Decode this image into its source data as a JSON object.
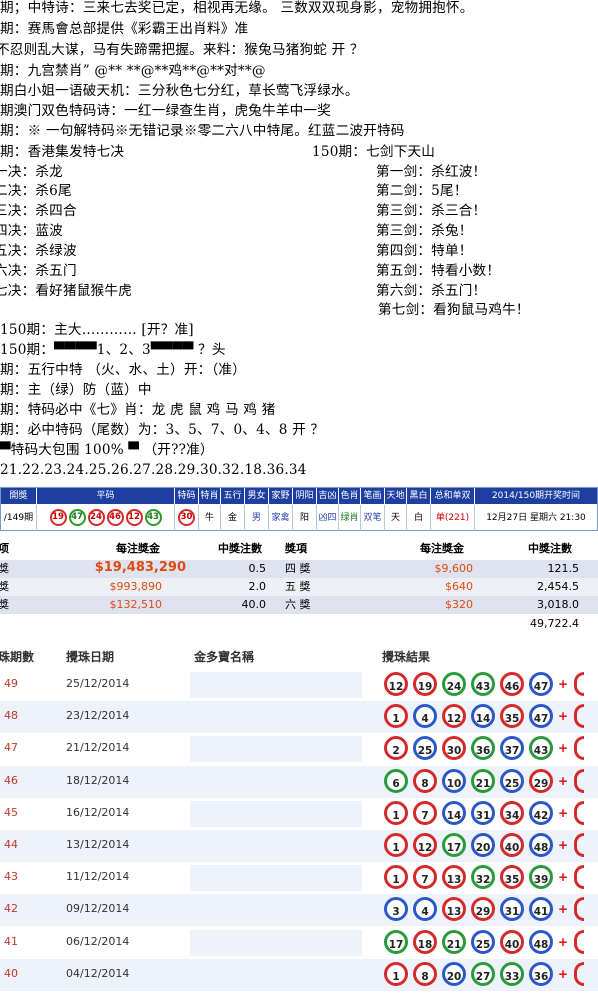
{
  "text_lines": [
    "期；中特诗：三来七去奖已定，相视再无缘。 三数双双现身影，宠物拥抱怀。",
    "期：赛馬會总部提供《彩霸王出肖料》准",
    "不忍则乱大谋，马有失蹄需把握。来料：猴兔马猪狗蛇   开  ？",
    "期：九宫禁肖” @** **@**鸡**@**对**@",
    "期白小姐一语破天机：三分秋色七分红，草长莺飞浮绿水。",
    "期澳门双色特码诗：一红一绿查生肖，虎兔牛羊中一奖",
    "期：※ 一句解特码※无错记录※零二六八中特尾。红蓝二波开特码",
    "期：香港集发特七决"
  ],
  "jue_header": "150期：七剑下天山",
  "jue_left": [
    "一决：杀龙",
    "二决：杀6尾",
    "三决：杀四合",
    "四决：蓝波",
    "五决：杀绿波",
    "六决：杀五门",
    "七决：看好猪鼠猴牛虎"
  ],
  "jian_right": [
    "第一剑：杀红波！",
    "第二剑：5尾！",
    "第三剑：杀三合！",
    "第三剑：杀兔！",
    "第四剑：特单！",
    "第五剑：特看小数！",
    "第六剑：杀五门！",
    "第七剑：看狗鼠马鸡牛！"
  ],
  "lines2": [
    "150期：主大………… [开？准]",
    "150期：▀▀▀▀1、2、3▀▀▀▀ ？头",
    "期：五行中特  （火、水、土）开：（准）",
    "期：主（绿）防（蓝）中",
    "期：特码必中《七》肖：龙 虎 鼠 鸡 马 鸡 猪",
    "期：必中特码（尾数）为：3、5、7、0、4、8  开 ？",
    "▀特码大包围 100%  ▀  （开??准）",
    "21.22.23.24.25.26.27.28.29.30.32.18.36.34"
  ],
  "strip": {
    "headers": [
      "開獎",
      "平码",
      "特码",
      "特肖",
      "五行",
      "男女",
      "家野",
      "阴阳",
      "吉凶",
      "色肖",
      "笔画",
      "天地",
      "黑白",
      "总和单双",
      "2014/150期开奖时间"
    ],
    "period": "/149期",
    "numbers": [
      "19",
      "47",
      "24",
      "46",
      "12",
      "43"
    ],
    "special": "30",
    "values": [
      "牛",
      "金",
      "男",
      "家禽",
      "阳",
      "凶四",
      "绿肖",
      "双笔",
      "天",
      "白",
      "单(221)",
      "12月27日 星期六 21:30"
    ]
  },
  "prize": {
    "headers": [
      "项",
      "每注獎金",
      "中獎注數",
      "獎項",
      "每注獎金",
      "中獎注數"
    ],
    "rows": [
      [
        "獎",
        "$19,483,290",
        "0.5",
        "四 獎",
        "$9,600",
        "121.5"
      ],
      [
        "獎",
        "$993,890",
        "2.0",
        "五 獎",
        "$640",
        "2,454.5"
      ],
      [
        "獎",
        "$132,510",
        "40.0",
        "六 獎",
        "$320",
        "3,018.0"
      ]
    ],
    "total": "49,722.4"
  },
  "history": {
    "headers": [
      "攪珠期數",
      "攪珠日期",
      "金多寶名稱",
      "攪珠結果"
    ],
    "rows": [
      {
        "no": "49",
        "date": "25/12/2014",
        "balls": [
          "12",
          "19",
          "24",
          "43",
          "46",
          "47"
        ],
        "colors": [
          "r",
          "r",
          "g",
          "g",
          "r",
          "b"
        ]
      },
      {
        "no": "48",
        "date": "23/12/2014",
        "balls": [
          "1",
          "4",
          "12",
          "14",
          "35",
          "47"
        ],
        "colors": [
          "r",
          "b",
          "r",
          "b",
          "r",
          "b"
        ]
      },
      {
        "no": "47",
        "date": "21/12/2014",
        "balls": [
          "2",
          "25",
          "30",
          "36",
          "37",
          "43"
        ],
        "colors": [
          "r",
          "b",
          "r",
          "g",
          "b",
          "g"
        ]
      },
      {
        "no": "46",
        "date": "18/12/2014",
        "balls": [
          "6",
          "8",
          "10",
          "21",
          "25",
          "29"
        ],
        "colors": [
          "g",
          "r",
          "b",
          "g",
          "b",
          "r"
        ]
      },
      {
        "no": "45",
        "date": "16/12/2014",
        "balls": [
          "1",
          "7",
          "14",
          "31",
          "34",
          "42"
        ],
        "colors": [
          "r",
          "r",
          "b",
          "b",
          "r",
          "b"
        ]
      },
      {
        "no": "44",
        "date": "13/12/2014",
        "balls": [
          "1",
          "12",
          "17",
          "20",
          "40",
          "48"
        ],
        "colors": [
          "r",
          "r",
          "g",
          "b",
          "r",
          "b"
        ]
      },
      {
        "no": "43",
        "date": "11/12/2014",
        "balls": [
          "1",
          "7",
          "13",
          "32",
          "35",
          "39"
        ],
        "colors": [
          "r",
          "r",
          "r",
          "g",
          "r",
          "g"
        ]
      },
      {
        "no": "42",
        "date": "09/12/2014",
        "balls": [
          "3",
          "4",
          "13",
          "29",
          "31",
          "41"
        ],
        "colors": [
          "b",
          "b",
          "r",
          "r",
          "b",
          "b"
        ]
      },
      {
        "no": "41",
        "date": "06/12/2014",
        "balls": [
          "17",
          "18",
          "21",
          "25",
          "40",
          "48"
        ],
        "colors": [
          "g",
          "r",
          "g",
          "b",
          "r",
          "b"
        ]
      },
      {
        "no": "40",
        "date": "04/12/2014",
        "balls": [
          "1",
          "8",
          "20",
          "27",
          "33",
          "36"
        ],
        "colors": [
          "r",
          "r",
          "b",
          "g",
          "g",
          "b"
        ]
      }
    ]
  }
}
